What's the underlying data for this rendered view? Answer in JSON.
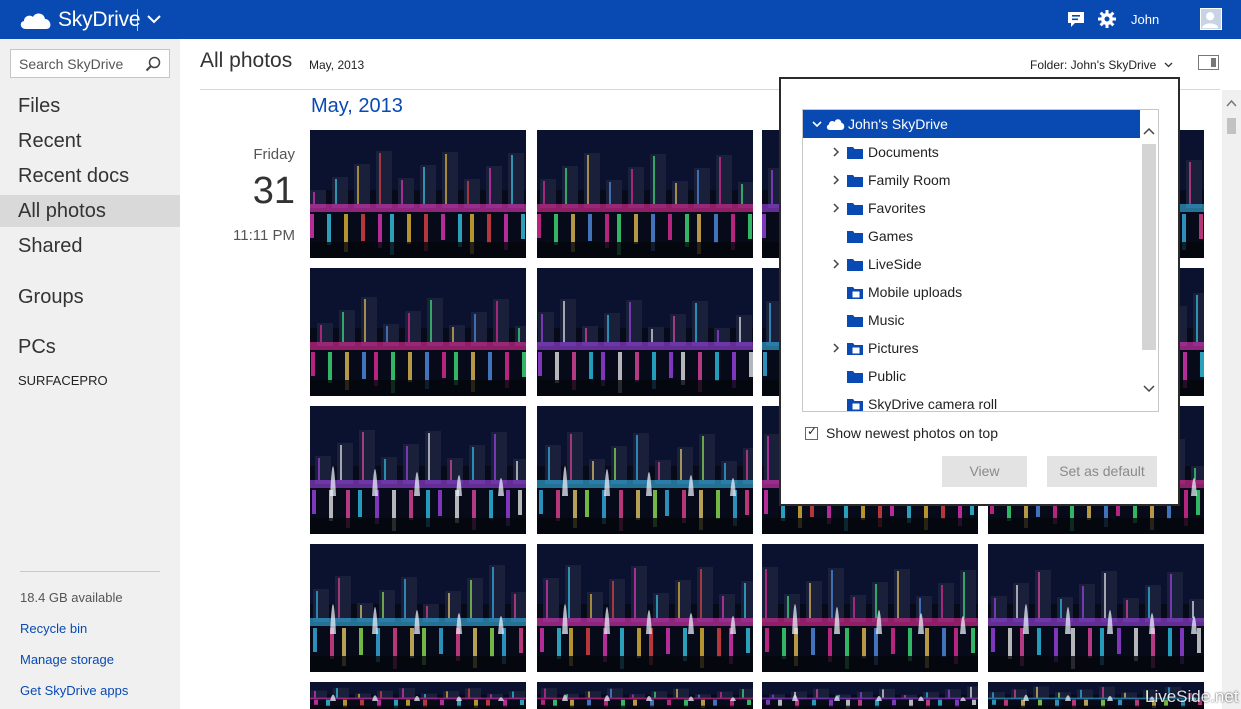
{
  "header": {
    "app_name": "SkyDrive",
    "user_name": "John",
    "colors": {
      "bar": "#094ab2"
    },
    "icons": [
      "skydrive-cloud-icon",
      "chevron-down-icon",
      "feedback-icon",
      "gear-icon",
      "avatar-icon"
    ]
  },
  "sidebar": {
    "search_placeholder": "Search SkyDrive",
    "nav": [
      {
        "label": "Files",
        "active": false
      },
      {
        "label": "Recent",
        "active": false
      },
      {
        "label": "Recent docs",
        "active": false
      },
      {
        "label": "All photos",
        "active": true
      },
      {
        "label": "Shared",
        "active": false
      }
    ],
    "groups_label": "Groups",
    "pcs_label": "PCs",
    "pc_name": "SURFACEPRO",
    "storage": "18.4 GB available",
    "links": [
      "Recycle bin",
      "Manage storage",
      "Get SkyDrive apps"
    ]
  },
  "main": {
    "title": "All photos",
    "breadcrumb_date": "May, 2013",
    "folder_selector": "Folder: John's SkyDrive",
    "month_heading": "May, 2013",
    "date_group": {
      "weekday": "Friday",
      "day": "31",
      "time": "11:11 PM"
    }
  },
  "folder_dialog": {
    "root": "John's SkyDrive",
    "folders": [
      {
        "label": "Documents",
        "expandable": true,
        "shared": false
      },
      {
        "label": "Family Room",
        "expandable": true,
        "shared": false
      },
      {
        "label": "Favorites",
        "expandable": true,
        "shared": false
      },
      {
        "label": "Games",
        "expandable": false,
        "shared": false
      },
      {
        "label": "LiveSide",
        "expandable": true,
        "shared": false
      },
      {
        "label": "Mobile uploads",
        "expandable": false,
        "shared": true
      },
      {
        "label": "Music",
        "expandable": false,
        "shared": false
      },
      {
        "label": "Pictures",
        "expandable": true,
        "shared": true
      },
      {
        "label": "Public",
        "expandable": false,
        "shared": false
      },
      {
        "label": "SkyDrive camera roll",
        "expandable": false,
        "shared": true
      }
    ],
    "checkbox_label": "Show newest photos on top",
    "checkbox_checked": true,
    "view_button": "View",
    "default_button": "Set as default"
  },
  "watermark": "LiveSide.net"
}
